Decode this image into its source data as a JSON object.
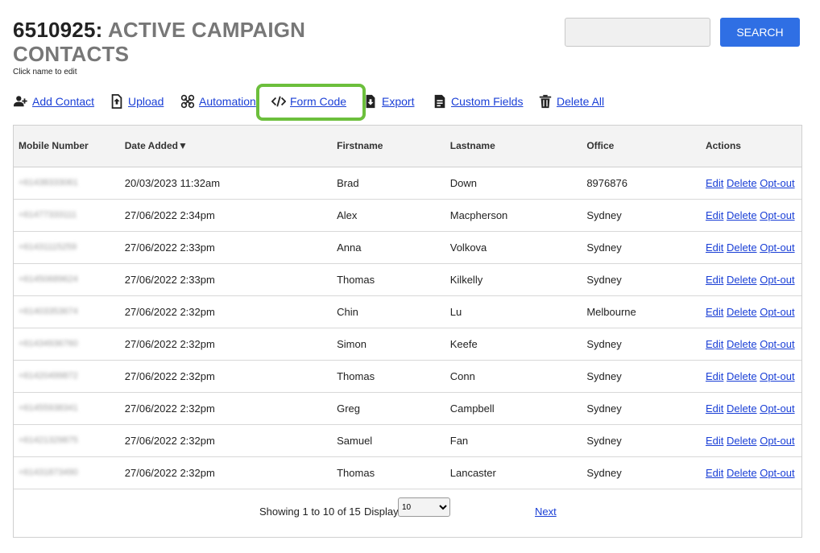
{
  "header": {
    "id": "6510925:",
    "name": "ACTIVE CAMPAIGN CONTACTS",
    "subtitle": "Click name to edit"
  },
  "search": {
    "placeholder": "",
    "button_label": "SEARCH"
  },
  "toolbar": {
    "items": [
      {
        "label": "Add Contact",
        "icon": "add-user-icon"
      },
      {
        "label": "Upload",
        "icon": "upload-file-icon"
      },
      {
        "label": "Automation",
        "icon": "automation-icon"
      },
      {
        "label": "Form Code",
        "icon": "code-icon"
      },
      {
        "label": "Export",
        "icon": "export-file-icon"
      },
      {
        "label": "Custom Fields",
        "icon": "custom-fields-icon"
      },
      {
        "label": "Delete All",
        "icon": "trash-icon"
      }
    ],
    "highlight_color": "#6cbf3c"
  },
  "table": {
    "columns": [
      "Mobile Number",
      "Date Added▼",
      "Firstname",
      "Lastname",
      "Office",
      "Actions"
    ],
    "actions": [
      "Edit",
      "Delete",
      "Opt-out"
    ],
    "rows": [
      {
        "mobile": "+61438333061",
        "date": "20/03/2023 11:32am",
        "first": "Brad",
        "last": "Down",
        "office": "8976876"
      },
      {
        "mobile": "+61477333111",
        "date": "27/06/2022 2:34pm",
        "first": "Alex",
        "last": "Macpherson",
        "office": "Sydney"
      },
      {
        "mobile": "+61431115259",
        "date": "27/06/2022 2:33pm",
        "first": "Anna",
        "last": "Volkova",
        "office": "Sydney"
      },
      {
        "mobile": "+61450689624",
        "date": "27/06/2022 2:33pm",
        "first": "Thomas",
        "last": "Kilkelly",
        "office": "Sydney"
      },
      {
        "mobile": "+61403353674",
        "date": "27/06/2022 2:32pm",
        "first": "Chin",
        "last": "Lu",
        "office": "Melbourne"
      },
      {
        "mobile": "+61434936760",
        "date": "27/06/2022 2:32pm",
        "first": "Simon",
        "last": "Keefe",
        "office": "Sydney"
      },
      {
        "mobile": "+61420499872",
        "date": "27/06/2022 2:32pm",
        "first": "Thomas",
        "last": "Conn",
        "office": "Sydney"
      },
      {
        "mobile": "+61455938341",
        "date": "27/06/2022 2:32pm",
        "first": "Greg",
        "last": "Campbell",
        "office": "Sydney"
      },
      {
        "mobile": "+61421329875",
        "date": "27/06/2022 2:32pm",
        "first": "Samuel",
        "last": "Fan",
        "office": "Sydney"
      },
      {
        "mobile": "+61431873490",
        "date": "27/06/2022 2:32pm",
        "first": "Thomas",
        "last": "Lancaster",
        "office": "Sydney"
      }
    ]
  },
  "pagination": {
    "showing": "Showing 1 to 10 of 15",
    "display_label": "Display",
    "display_value": "10",
    "next_label": "Next"
  },
  "colors": {
    "accent": "#2f6fe4",
    "link": "#1a3fd6"
  }
}
